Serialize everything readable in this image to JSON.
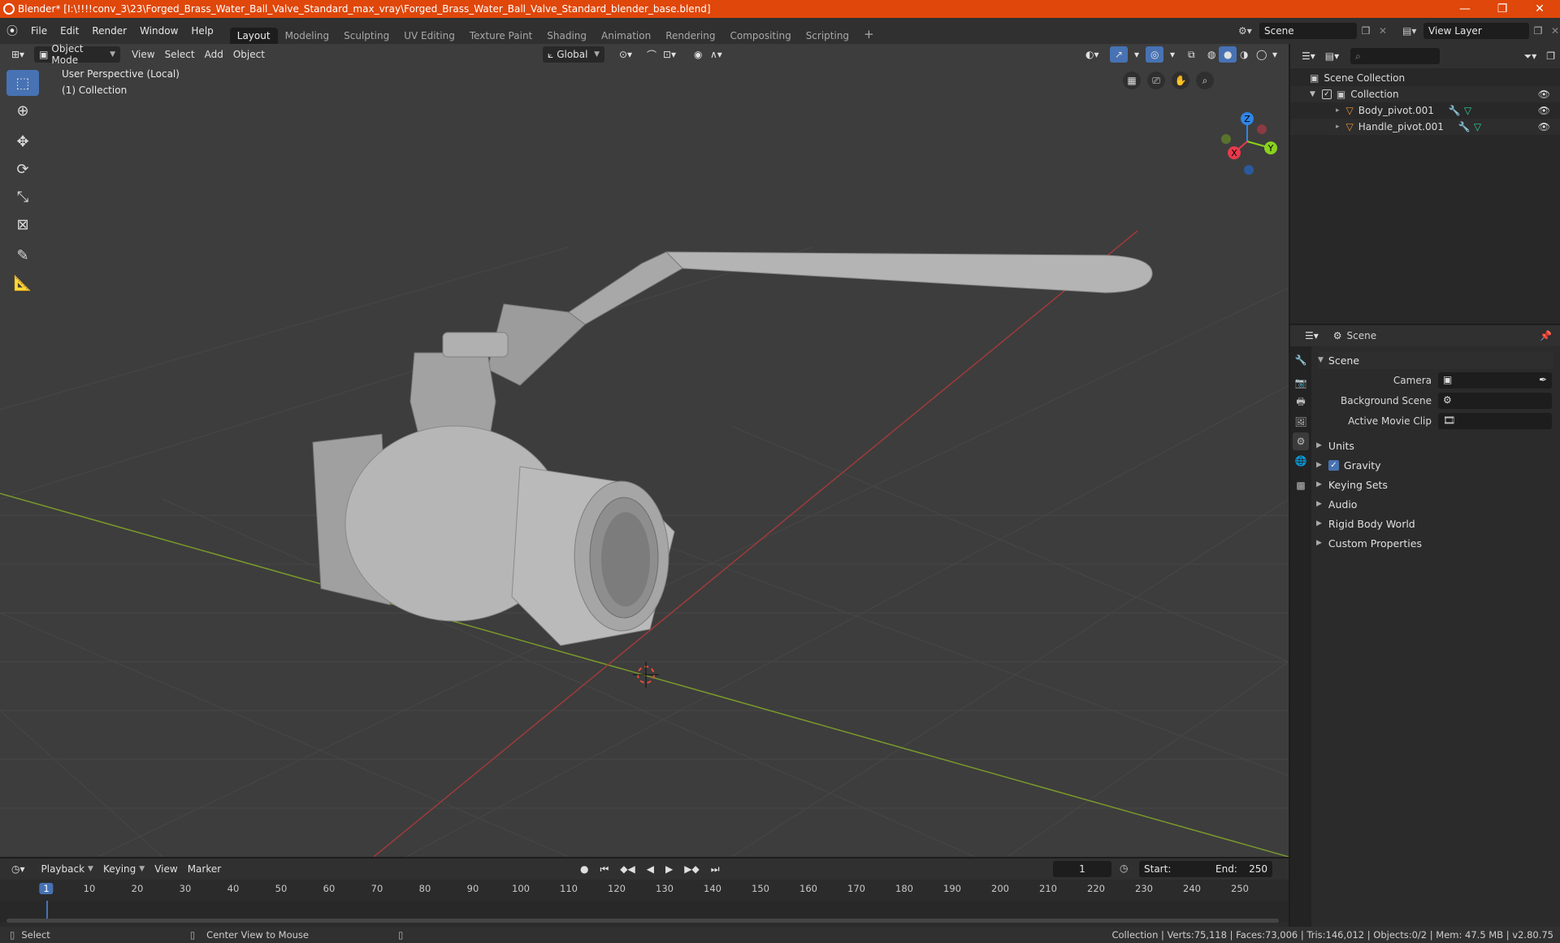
{
  "titlebar": {
    "title": "Blender* [I:\\!!!!conv_3\\23\\Forged_Brass_Water_Ball_Valve_Standard_max_vray\\Forged_Brass_Water_Ball_Valve_Standard_blender_base.blend]",
    "minimize": "—",
    "maximize": "❐",
    "close": "✕"
  },
  "menu": [
    "File",
    "Edit",
    "Render",
    "Window",
    "Help"
  ],
  "workspaces": [
    "Layout",
    "Modeling",
    "Sculpting",
    "UV Editing",
    "Texture Paint",
    "Shading",
    "Animation",
    "Rendering",
    "Compositing",
    "Scripting"
  ],
  "active_workspace": "Layout",
  "add_workspace": "+",
  "scene_field": "Scene",
  "view_layer_field": "View Layer",
  "viewport": {
    "mode": "Object Mode",
    "menus": [
      "View",
      "Select",
      "Add",
      "Object"
    ],
    "transform_orientation": "Global",
    "overlay_line1": "User Perspective (Local)",
    "overlay_line2": "(1) Collection",
    "gizmo_axes": [
      "Z",
      "Y",
      "X"
    ],
    "colors": {
      "x_axis": "#e83a4c",
      "y_axis": "#8ad11e",
      "z_axis": "#2e86e8",
      "active": "#4772b3"
    }
  },
  "tools": [
    "select-box",
    "cursor",
    "move",
    "rotate",
    "scale",
    "transform",
    "annotate",
    "measure"
  ],
  "timeline": {
    "menus": [
      "Playback",
      "Keying",
      "View",
      "Marker"
    ],
    "current_frame": "1",
    "start_label": "Start:",
    "start": "1",
    "end_label": "End:",
    "end": "250",
    "ticks": [
      "1",
      "10",
      "20",
      "30",
      "40",
      "50",
      "60",
      "70",
      "80",
      "90",
      "100",
      "110",
      "120",
      "130",
      "140",
      "150",
      "160",
      "170",
      "180",
      "190",
      "200",
      "210",
      "220",
      "230",
      "240",
      "250"
    ]
  },
  "outliner": {
    "root": "Scene Collection",
    "collection": "Collection",
    "objects": [
      "Body_pivot.001",
      "Handle_pivot.001"
    ]
  },
  "properties": {
    "header": "Scene",
    "panel": "Scene",
    "fields": [
      {
        "label": "Camera"
      },
      {
        "label": "Background Scene"
      },
      {
        "label": "Active Movie Clip"
      }
    ],
    "subpanels": [
      "Units",
      "Gravity",
      "Keying Sets",
      "Audio",
      "Rigid Body World",
      "Custom Properties"
    ]
  },
  "statusbar": {
    "left": "Select",
    "middle": "Center View to Mouse",
    "right": "Collection | Verts:75,118 | Faces:73,006 | Tris:146,012 | Objects:0/2 | Mem: 47.5 MB | v2.80.75"
  }
}
